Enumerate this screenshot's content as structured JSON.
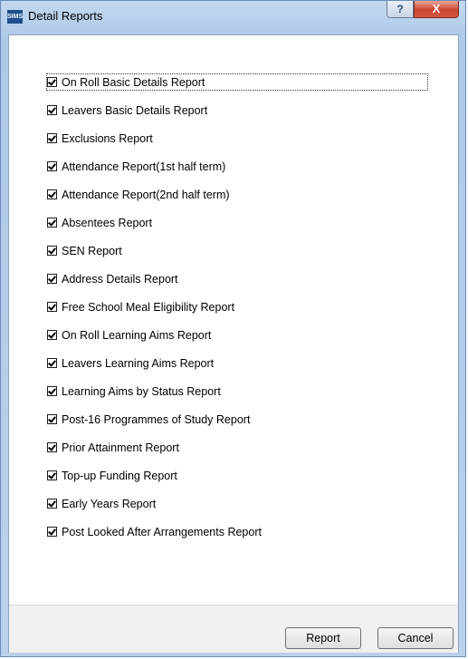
{
  "window": {
    "title": "Detail Reports",
    "app_icon_text": "SIMS",
    "help_label": "?",
    "close_label": "X"
  },
  "reports": [
    {
      "label": "On Roll Basic Details Report",
      "checked": true
    },
    {
      "label": "Leavers Basic Details Report",
      "checked": true
    },
    {
      "label": "Exclusions Report",
      "checked": true
    },
    {
      "label": "Attendance Report(1st half term)",
      "checked": true
    },
    {
      "label": "Attendance Report(2nd half term)",
      "checked": true
    },
    {
      "label": "Absentees Report",
      "checked": true
    },
    {
      "label": "SEN Report",
      "checked": true
    },
    {
      "label": "Address Details Report",
      "checked": true
    },
    {
      "label": "Free School Meal Eligibility Report",
      "checked": true
    },
    {
      "label": "On Roll Learning Aims Report",
      "checked": true
    },
    {
      "label": "Leavers Learning Aims Report",
      "checked": true
    },
    {
      "label": "Learning Aims by Status Report",
      "checked": true
    },
    {
      "label": "Post-16 Programmes of Study Report",
      "checked": true
    },
    {
      "label": "Prior Attainment Report",
      "checked": true
    },
    {
      "label": "Top-up Funding Report",
      "checked": true
    },
    {
      "label": "Early Years Report",
      "checked": true
    },
    {
      "label": "Post Looked After Arrangements Report",
      "checked": true
    }
  ],
  "buttons": {
    "report_label": "Report",
    "cancel_label": "Cancel"
  }
}
